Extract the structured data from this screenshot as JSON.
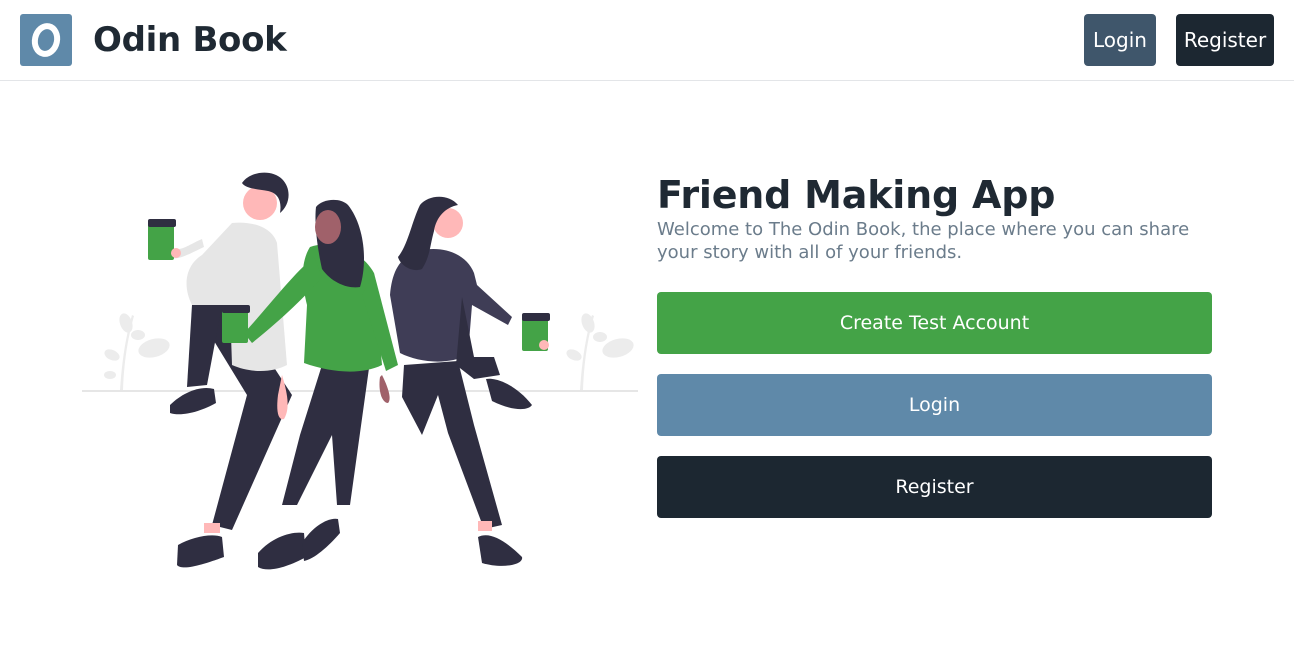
{
  "header": {
    "brand_name": "Odin Book",
    "login_label": "Login",
    "register_label": "Register"
  },
  "hero": {
    "title": "Friend Making App",
    "subtitle": "Welcome to The Odin Book, the place where you can share your story with all of your friends."
  },
  "actions": {
    "create_test_account_label": "Create Test Account",
    "login_label": "Login",
    "register_label": "Register"
  },
  "colors": {
    "brand_blue": "#5f89a9",
    "green": "#44a347",
    "dark": "#1c2731",
    "slate": "#3f566b"
  },
  "icons": {
    "logo": "odin-book-logo-icon"
  }
}
